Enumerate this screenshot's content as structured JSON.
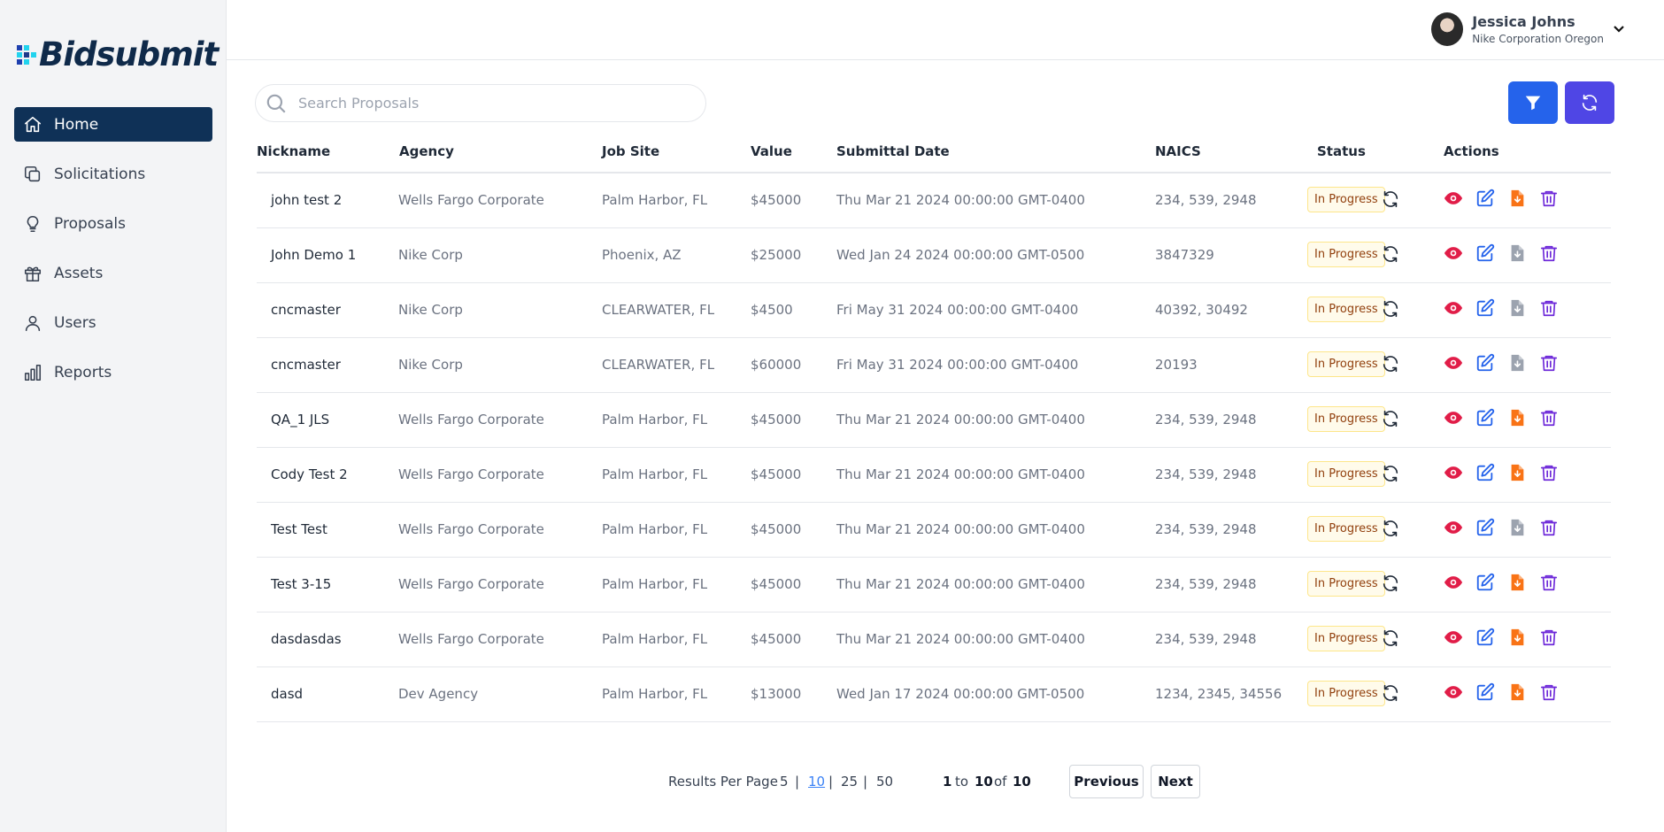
{
  "brand": {
    "name": "Bidsubmit"
  },
  "sidebar": {
    "items": [
      {
        "label": "Home",
        "icon": "home-icon",
        "active": true
      },
      {
        "label": "Solicitations",
        "icon": "copy-icon",
        "active": false
      },
      {
        "label": "Proposals",
        "icon": "lightbulb-icon",
        "active": false
      },
      {
        "label": "Assets",
        "icon": "gift-icon",
        "active": false
      },
      {
        "label": "Users",
        "icon": "user-icon",
        "active": false
      },
      {
        "label": "Reports",
        "icon": "bar-chart-icon",
        "active": false
      }
    ]
  },
  "user": {
    "name": "Jessica Johns",
    "org": "Nike Corporation Oregon"
  },
  "search": {
    "placeholder": "Search Proposals",
    "value": ""
  },
  "colors": {
    "nav_active": "#0f3157",
    "filter_btn": "#2563eb",
    "refresh_btn": "#4f46e5",
    "view": "#e11d48",
    "edit": "#2563eb",
    "download": "#f97316",
    "download_disabled": "#9ca3af",
    "delete": "#6d28d9"
  },
  "table": {
    "headers": {
      "nickname": "Nickname",
      "agency": "Agency",
      "job_site": "Job Site",
      "value": "Value",
      "submittal_date": "Submittal Date",
      "naics": "NAICS",
      "status": "Status",
      "actions": "Actions"
    },
    "rows": [
      {
        "nickname": "john test 2",
        "agency": "Wells Fargo Corporate",
        "job_site": "Palm Harbor, FL",
        "value": "$45000",
        "submittal_date": "Thu Mar 21 2024 00:00:00 GMT-0400",
        "naics": "234, 539, 2948",
        "status": "In Progress",
        "download_enabled": true
      },
      {
        "nickname": "John Demo 1",
        "agency": "Nike Corp",
        "job_site": "Phoenix, AZ",
        "value": "$25000",
        "submittal_date": "Wed Jan 24 2024 00:00:00 GMT-0500",
        "naics": "3847329",
        "status": "In Progress",
        "download_enabled": false
      },
      {
        "nickname": "cncmaster",
        "agency": "Nike Corp",
        "job_site": "CLEARWATER, FL",
        "value": "$4500",
        "submittal_date": "Fri May 31 2024 00:00:00 GMT-0400",
        "naics": "40392, 30492",
        "status": "In Progress",
        "download_enabled": false
      },
      {
        "nickname": "cncmaster",
        "agency": "Nike Corp",
        "job_site": "CLEARWATER, FL",
        "value": "$60000",
        "submittal_date": "Fri May 31 2024 00:00:00 GMT-0400",
        "naics": "20193",
        "status": "In Progress",
        "download_enabled": false
      },
      {
        "nickname": "QA_1 JLS",
        "agency": "Wells Fargo Corporate",
        "job_site": "Palm Harbor, FL",
        "value": "$45000",
        "submittal_date": "Thu Mar 21 2024 00:00:00 GMT-0400",
        "naics": "234, 539, 2948",
        "status": "In Progress",
        "download_enabled": true
      },
      {
        "nickname": "Cody Test 2",
        "agency": "Wells Fargo Corporate",
        "job_site": "Palm Harbor, FL",
        "value": "$45000",
        "submittal_date": "Thu Mar 21 2024 00:00:00 GMT-0400",
        "naics": "234, 539, 2948",
        "status": "In Progress",
        "download_enabled": true
      },
      {
        "nickname": "Test Test",
        "agency": "Wells Fargo Corporate",
        "job_site": "Palm Harbor, FL",
        "value": "$45000",
        "submittal_date": "Thu Mar 21 2024 00:00:00 GMT-0400",
        "naics": "234, 539, 2948",
        "status": "In Progress",
        "download_enabled": false
      },
      {
        "nickname": "Test 3-15",
        "agency": "Wells Fargo Corporate",
        "job_site": "Palm Harbor, FL",
        "value": "$45000",
        "submittal_date": "Thu Mar 21 2024 00:00:00 GMT-0400",
        "naics": "234, 539, 2948",
        "status": "In Progress",
        "download_enabled": true
      },
      {
        "nickname": "dasdasdas",
        "agency": "Wells Fargo Corporate",
        "job_site": "Palm Harbor, FL",
        "value": "$45000",
        "submittal_date": "Thu Mar 21 2024 00:00:00 GMT-0400",
        "naics": "234, 539, 2948",
        "status": "In Progress",
        "download_enabled": true
      },
      {
        "nickname": "dasd",
        "agency": "Dev Agency",
        "job_site": "Palm Harbor, FL",
        "value": "$13000",
        "submittal_date": "Wed Jan 17 2024 00:00:00 GMT-0500",
        "naics": "1234, 2345, 34556",
        "status": "In Progress",
        "download_enabled": true
      }
    ]
  },
  "pagination": {
    "results_per_page_label": "Results Per Page",
    "options": [
      "5",
      "10",
      "25",
      "50"
    ],
    "selected": "10",
    "separator": "|",
    "from": "1",
    "to_word": "to",
    "to": "10",
    "of_word": "of",
    "total": "10",
    "previous_label": "Previous",
    "next_label": "Next"
  }
}
